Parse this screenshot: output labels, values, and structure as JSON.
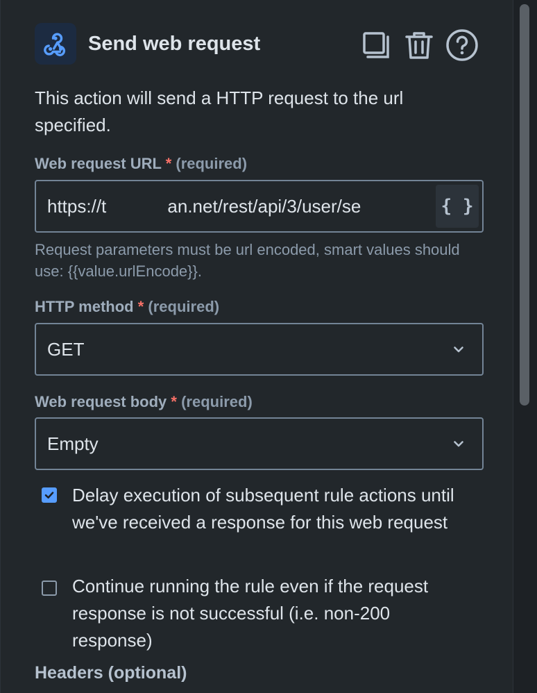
{
  "header": {
    "title": "Send web request",
    "icon": "webhook-icon",
    "actions": [
      {
        "name": "duplicate",
        "icon": "copy-icon"
      },
      {
        "name": "delete",
        "icon": "trash-icon"
      },
      {
        "name": "help",
        "icon": "help-icon"
      }
    ]
  },
  "description": "This action will send a HTTP request to the url specified.",
  "url_field": {
    "label": "Web request URL",
    "required_star": "*",
    "required_text": "(required)",
    "value": "https://t          .atlassian.net/rest/api/3/user/se",
    "smart_value_button": "{ }",
    "helper_text": "Request parameters must be url encoded, smart values should use: {{value.urlEncode}}."
  },
  "method_field": {
    "label": "HTTP method",
    "required_star": "*",
    "required_text": "(required)",
    "value": "GET"
  },
  "body_field": {
    "label": "Web request body",
    "required_star": "*",
    "required_text": "(required)",
    "value": "Empty"
  },
  "options": [
    {
      "checked": true,
      "label": "Delay execution of subsequent rule actions until we've received a response for this web request"
    },
    {
      "checked": false,
      "label": "Continue running the rule even if the request response is not successful (i.e. non-200 response)"
    }
  ],
  "headers_section": {
    "title": "Headers (optional)"
  },
  "colors": {
    "background": "#22272b",
    "text": "#dee4ea",
    "subtle_text": "#8c9bab",
    "required": "#f87168",
    "accent": "#579dff",
    "border": "#738496"
  }
}
